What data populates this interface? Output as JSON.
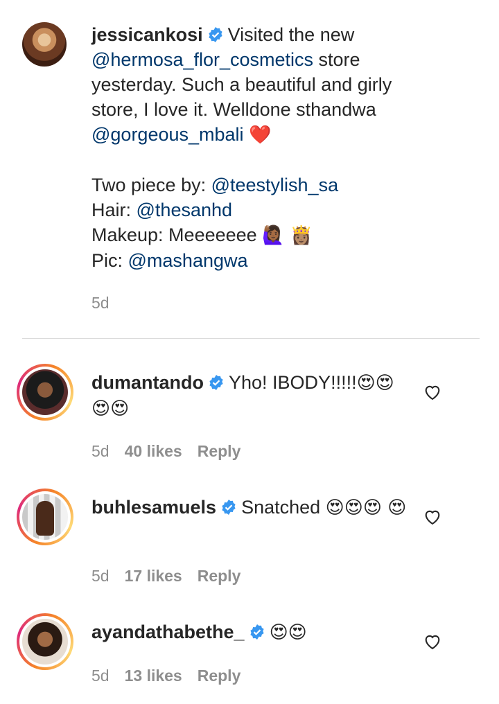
{
  "caption": {
    "username": "jessicankosi",
    "text_1": "Visited the new",
    "mention_1": "@hermosa_flor_cosmetics",
    "text_2": " store yesterday. Such a beautiful and girly store, I love it. Welldone sthandwa ",
    "mention_2": "@gorgeous_mbali",
    "heart": "❤️",
    "line_1_label": "Two piece by: ",
    "line_1_mention": "@teestylish_sa",
    "line_2_label": "Hair: ",
    "line_2_mention": "@thesanhd",
    "line_3_label": "Makeup: Meeeeeee ",
    "line_3_emoji": "🙋🏾‍♀️ 👸🏽",
    "line_4_label": "Pic: ",
    "line_4_mention": "@mashangwa",
    "time": "5d"
  },
  "comments": [
    {
      "username": "dumantando",
      "text": "Yho! IBODY!!!!!",
      "emoji": "😍😍 😍😍",
      "time": "5d",
      "likes": "40 likes",
      "reply": "Reply"
    },
    {
      "username": "buhlesamuels",
      "text": "Snatched ",
      "emoji": "😍😍😍 😍",
      "time": "5d",
      "likes": "17 likes",
      "reply": "Reply"
    },
    {
      "username": "ayandathabethe_",
      "text": "",
      "emoji": "😍😍",
      "time": "5d",
      "likes": "13 likes",
      "reply": "Reply"
    }
  ],
  "icons": {
    "verified": "verified-badge-icon",
    "like": "heart-outline-icon"
  },
  "colors": {
    "mention": "#00376b",
    "meta": "#8e8e8e",
    "verified": "#3897f0"
  }
}
